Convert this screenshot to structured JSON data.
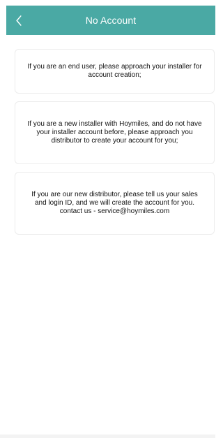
{
  "header": {
    "title": "No Account",
    "back_icon": "chevron-left-icon",
    "color": "#4aa9a4"
  },
  "messages": [
    {
      "text": "If you are an end user, please approach your installer for account creation;"
    },
    {
      "text": "If you are a new installer with Hoymiles, and do not have your installer account before, please approach you distributor to create your account for you;"
    },
    {
      "text": "If you are our new distributor, please tell us your sales and login ID, and we will create the account for you. contact us - service@hoymiles.com"
    }
  ]
}
